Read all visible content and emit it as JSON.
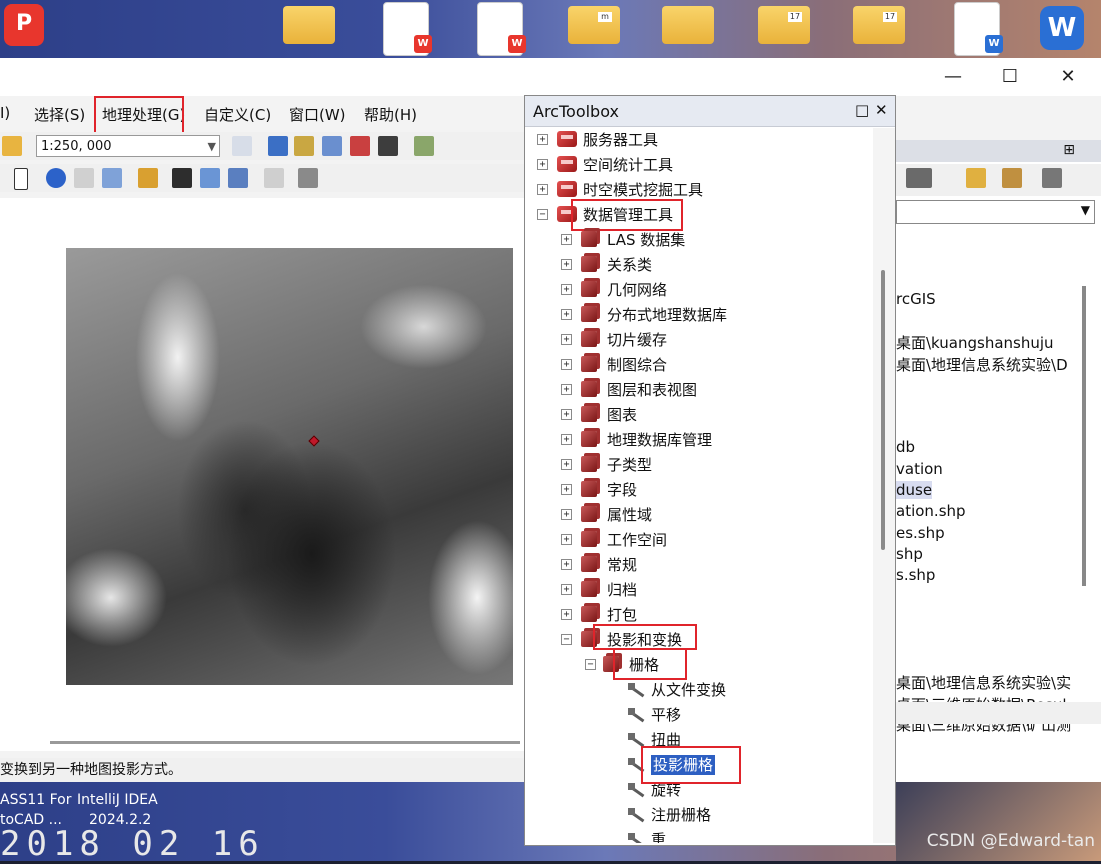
{
  "desktop": {
    "label1a": "ASS11 For",
    "label1b": "toCAD ...",
    "label2a": "IntelliJ IDEA",
    "label2b": "2024.2.2",
    "date": "2018 02 16",
    "watermark": "CSDN @Edward-tan"
  },
  "window": {
    "min": "—",
    "max": "☐",
    "close": "✕"
  },
  "menubar": {
    "items": [
      "I)",
      "选择(S)",
      "地理处理(G)",
      "自定义(C)",
      "窗口(W)",
      "帮助(H)"
    ]
  },
  "toolbar": {
    "scale": "1:250, 000"
  },
  "statusbar": {
    "text": "变换到另一种地图投影方式。"
  },
  "catalog": {
    "pin": "⊞",
    "lines": [
      "rcGIS",
      "桌面\\kuangshanshuju",
      "桌面\\地理信息系统实验\\D",
      "db",
      "vation",
      "duse",
      "ation.shp",
      "es.shp",
      "shp",
      "s.shp",
      "桌面\\地理信息系统实验\\实",
      "桌面\\三维原始数据\\Resul",
      "桌面\\三维原始数据\\矿山测"
    ]
  },
  "arctoolbox": {
    "title": "ArcToolbox",
    "float": "□",
    "close": "✕",
    "top_nodes": [
      "服务器工具",
      "空间统计工具",
      "时空模式挖掘工具",
      "数据管理工具"
    ],
    "dm_children": [
      "LAS 数据集",
      "关系类",
      "几何网络",
      "分布式地理数据库",
      "切片缓存",
      "制图综合",
      "图层和表视图",
      "图表",
      "地理数据库管理",
      "子类型",
      "字段",
      "属性域",
      "工作空间",
      "常规",
      "归档",
      "打包",
      "投影和变换"
    ],
    "raster_set": "栅格",
    "raster_tools": [
      "从文件变换",
      "平移",
      "扭曲",
      "投影栅格",
      "旋转",
      "注册栅格",
      "重..."
    ]
  }
}
